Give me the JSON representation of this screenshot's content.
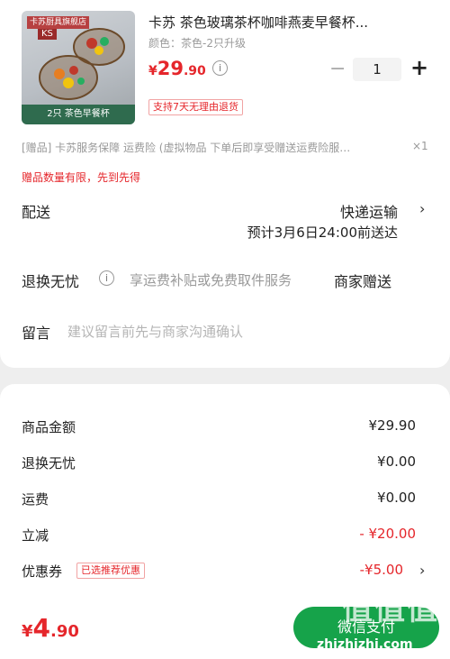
{
  "product": {
    "store_tag": "卡苏厨具旗舰店",
    "logo_text": "KS",
    "image_caption": "2只 茶色早餐杯",
    "title": "卡苏 茶色玻璃茶杯咖啡燕麦早餐杯...",
    "spec": "颜色：茶色-2只升级",
    "price_currency": "¥",
    "price_int": "29",
    "price_dec": ".90",
    "quantity": "1",
    "minus": "−",
    "plus": "+",
    "return_badge": "支持7天无理由退货"
  },
  "gift": {
    "line": "[赠品]  卡苏服务保障 运费险 (虚拟物品 下单后即享受赠送运费险服…",
    "qty": "×1",
    "limit": "赠品数量有限，先到先得"
  },
  "delivery": {
    "label": "配送",
    "method": "快递运输",
    "date": "预计3月6日24:00前送达"
  },
  "worry_free": {
    "label": "退换无忧",
    "desc": "享运费补贴或免费取件服务",
    "gift": "商家赠送"
  },
  "message": {
    "label": "留言",
    "placeholder": "建议留言前先与商家沟通确认"
  },
  "summary": {
    "items_label": "商品金额",
    "items_value": "¥29.90",
    "worry_label": "退换无忧",
    "worry_value": "¥0.00",
    "shipping_label": "运费",
    "shipping_value": "¥0.00",
    "discount_label": "立减",
    "discount_value": "- ¥20.00",
    "coupon_label": "优惠券",
    "coupon_badge": "已选推荐优惠",
    "coupon_value": "-¥5.00"
  },
  "footer": {
    "total_currency": "¥",
    "total_int": "4",
    "total_dec": ".90",
    "pay_label": "微信支付",
    "watermark_logo": "值值值",
    "watermark_url": "zhizhizhi.com"
  },
  "colors": {
    "accent_red": "#e5262b",
    "pay_green": "#16a34a"
  },
  "icons": [
    "info-icon",
    "chevron-right-icon",
    "minus-icon",
    "plus-icon"
  ]
}
